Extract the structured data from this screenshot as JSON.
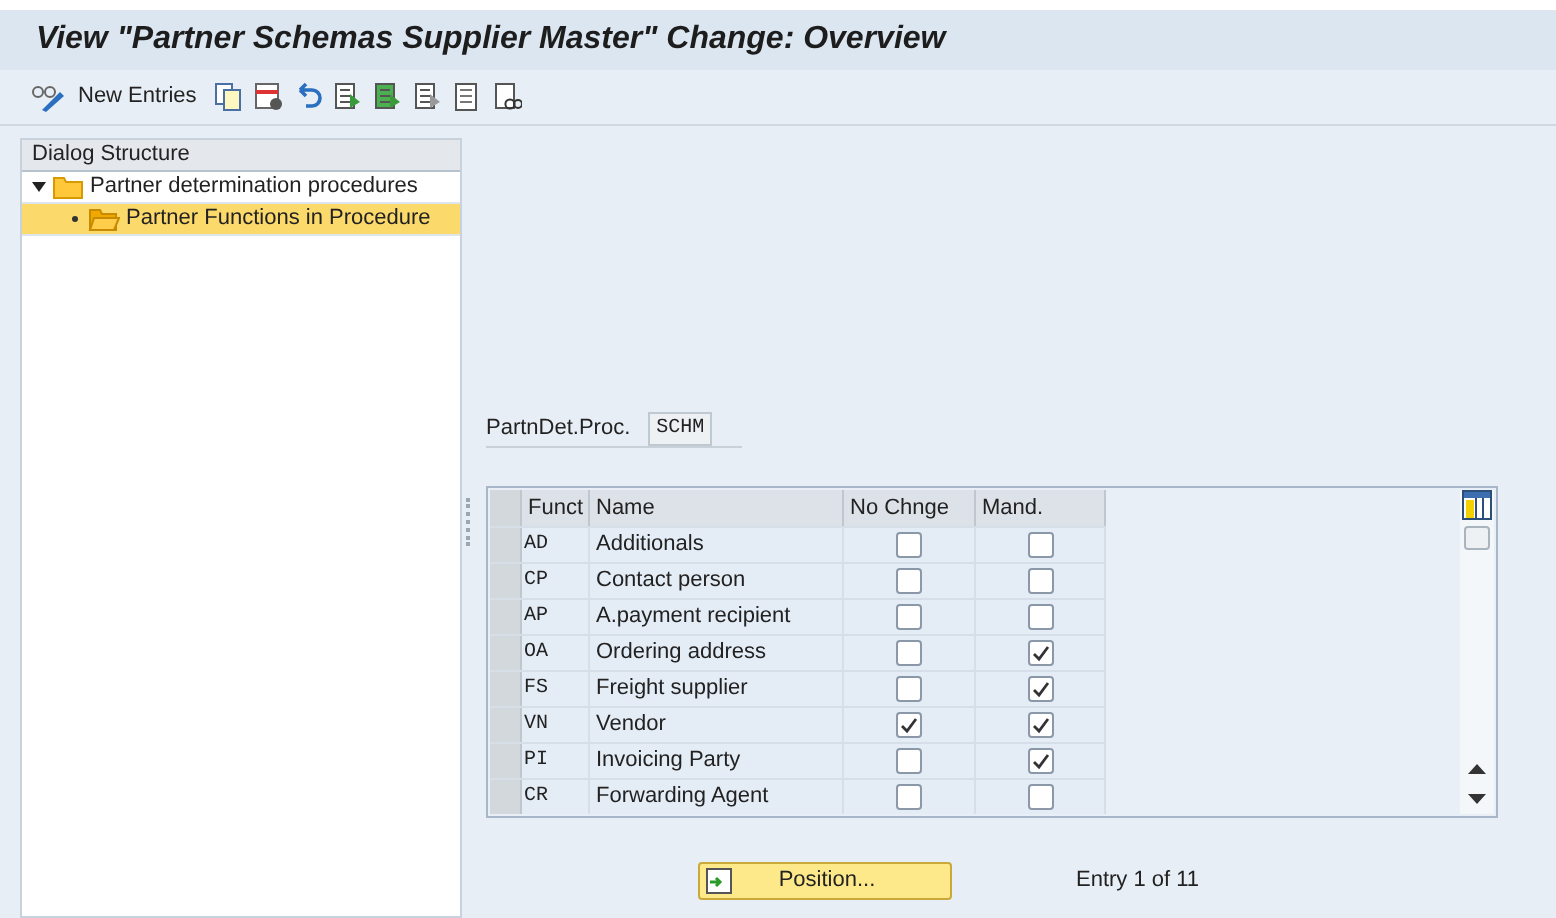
{
  "window": {
    "title": "View \"Partner Schemas Supplier Master\" Change: Overview"
  },
  "toolbar": {
    "new_entries": "New Entries"
  },
  "dialog_structure": {
    "title": "Dialog Structure",
    "items": [
      {
        "label": "Partner determination procedures",
        "expanded": true,
        "selected": false,
        "children": [
          {
            "label": "Partner Functions in Procedure",
            "selected": true
          }
        ]
      }
    ]
  },
  "procedure": {
    "label": "PartnDet.Proc.",
    "value": "SCHM"
  },
  "table": {
    "columns": [
      "Funct",
      "Name",
      "No Chnge",
      "Mand."
    ],
    "rows": [
      {
        "funct": "AD",
        "name": "Additionals",
        "no_change": false,
        "mandatory": false
      },
      {
        "funct": "CP",
        "name": "Contact person",
        "no_change": false,
        "mandatory": false
      },
      {
        "funct": "AP",
        "name": "A.payment recipient",
        "no_change": false,
        "mandatory": false
      },
      {
        "funct": "OA",
        "name": "Ordering address",
        "no_change": false,
        "mandatory": true
      },
      {
        "funct": "FS",
        "name": "Freight supplier",
        "no_change": false,
        "mandatory": true
      },
      {
        "funct": "VN",
        "name": "Vendor",
        "no_change": true,
        "mandatory": true
      },
      {
        "funct": "PI",
        "name": "Invoicing Party",
        "no_change": false,
        "mandatory": true
      },
      {
        "funct": "CR",
        "name": "Forwarding Agent",
        "no_change": false,
        "mandatory": false
      }
    ]
  },
  "position_button": "Position...",
  "entry_info": "Entry 1 of 11"
}
